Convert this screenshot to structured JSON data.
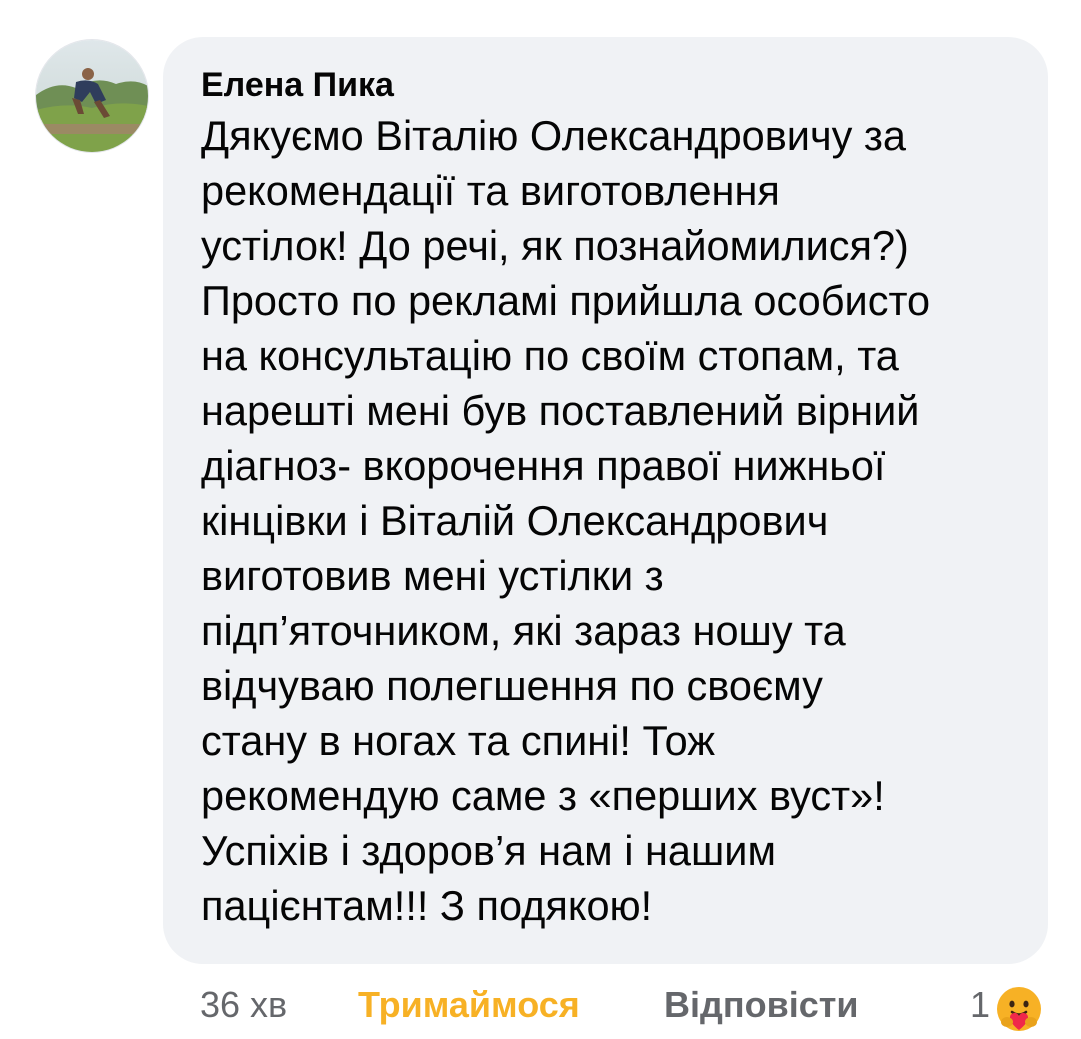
{
  "comment": {
    "author": "Елена Пика",
    "avatar_icon": "profile-photo",
    "lines": [
      "Дякуємо Віталію Олександровичу за",
      "рекомендації та виготовлення",
      "устілок! До речі, як познайомилися?)",
      "Просто по рекламі прийшла особисто",
      "на консультацію по своїм стопам, та",
      "нарешті мені був поставлений вірний",
      "діагноз- вкорочення правої нижньої",
      "кінцівки і Віталій Олександрович",
      "виготовив мені устілки з",
      "підп’яточником, які зараз ношу та",
      "відчуваю полегшення по своєму",
      "стану в ногах та спині! Тож",
      "рекомендую саме з «перших вуст»!",
      "Успіхів і здоров’я нам і нашим",
      "пацієнтам!!! З подякою!"
    ]
  },
  "actions": {
    "time": "36 хв",
    "react_label": "Тримаймося",
    "reply_label": "Відповісти",
    "reaction_count": "1",
    "reaction_icon": "care-reaction-icon"
  },
  "colors": {
    "bubble": "#f0f2f5",
    "text": "#050505",
    "muted": "#65676b",
    "care_reaction": "#f7b125"
  }
}
